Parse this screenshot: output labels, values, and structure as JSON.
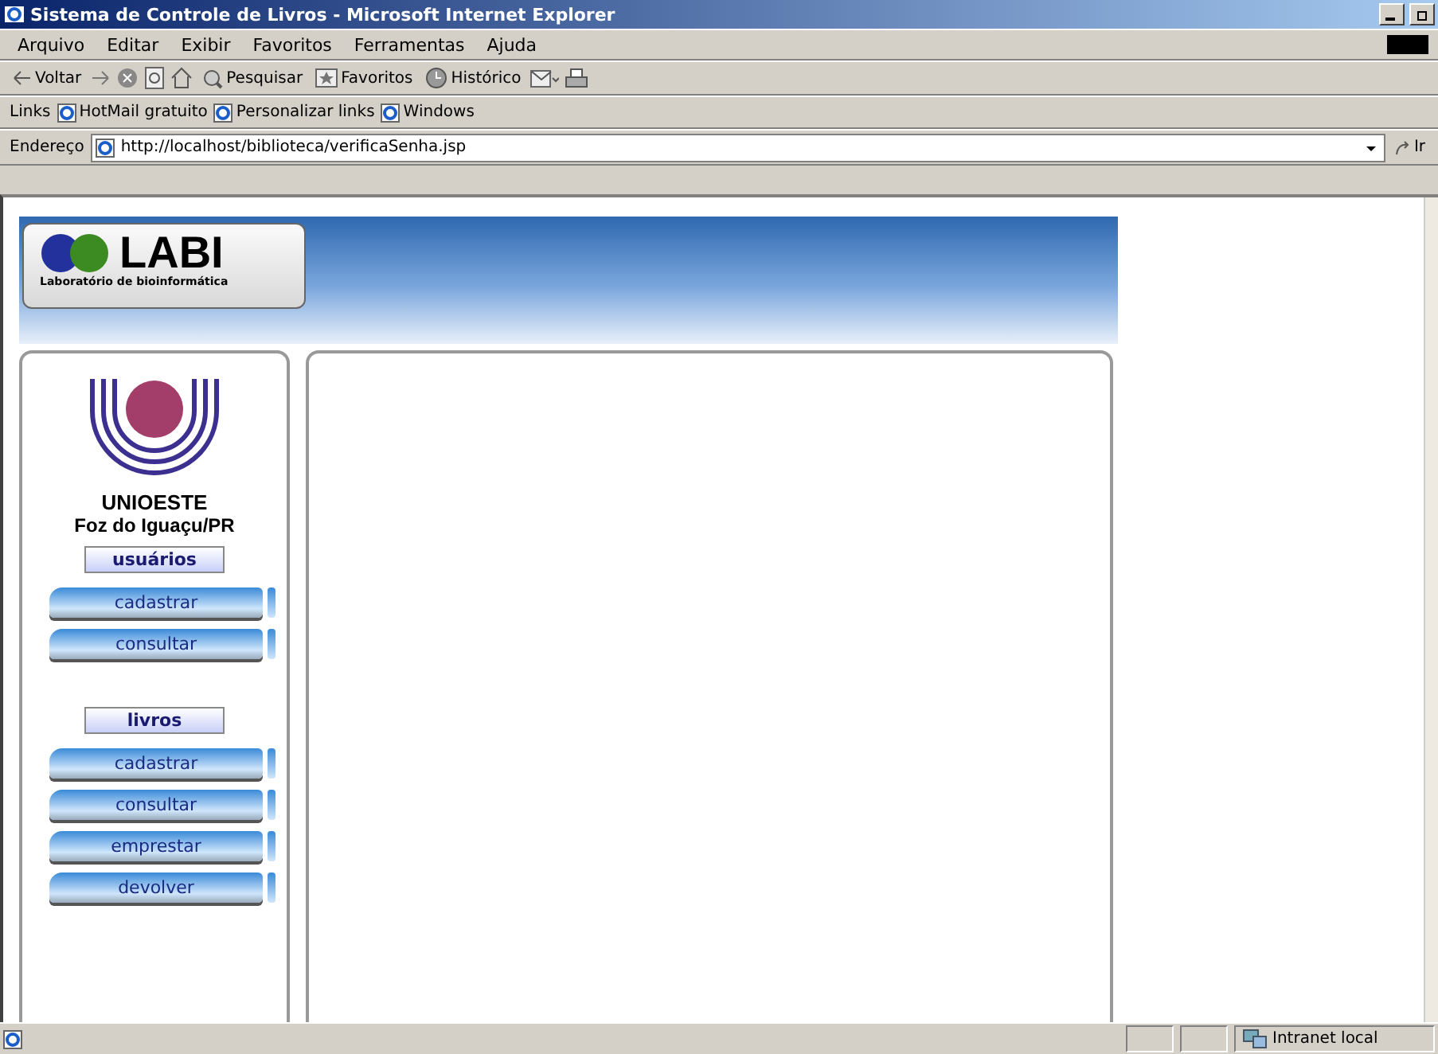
{
  "window": {
    "title": "Sistema de Controle de Livros - Microsoft Internet Explorer"
  },
  "menu": [
    "Arquivo",
    "Editar",
    "Exibir",
    "Favoritos",
    "Ferramentas",
    "Ajuda"
  ],
  "toolbar": [
    {
      "kind": "back",
      "label": "Voltar"
    },
    {
      "kind": "forward"
    },
    {
      "kind": "stop"
    },
    {
      "kind": "refresh"
    },
    {
      "kind": "home"
    },
    {
      "kind": "search",
      "label": "Pesquisar"
    },
    {
      "kind": "favorites",
      "label": "Favoritos"
    },
    {
      "kind": "history",
      "label": "Histórico"
    },
    {
      "kind": "mail"
    },
    {
      "kind": "print"
    }
  ],
  "links_bar": {
    "label": "Links",
    "links": [
      "HotMail gratuito",
      "Personalizar links",
      "Windows"
    ]
  },
  "address_bar": {
    "label": "Endereço",
    "url": "http://localhost/biblioteca/verificaSenha.jsp",
    "go": "Ir"
  },
  "page": {
    "banner": {
      "logo": "LABI",
      "subtitle": "Laboratório de bioinformática"
    },
    "university": {
      "name": "UNIOESTE",
      "city": "Foz do Iguaçu/PR"
    },
    "sections": [
      {
        "title": "usuários",
        "items": [
          "cadastrar",
          "consultar"
        ]
      },
      {
        "title": "livros",
        "items": [
          "cadastrar",
          "consultar",
          "emprestar",
          "devolver"
        ]
      }
    ]
  },
  "status_bar": {
    "zone": "Intranet local"
  }
}
